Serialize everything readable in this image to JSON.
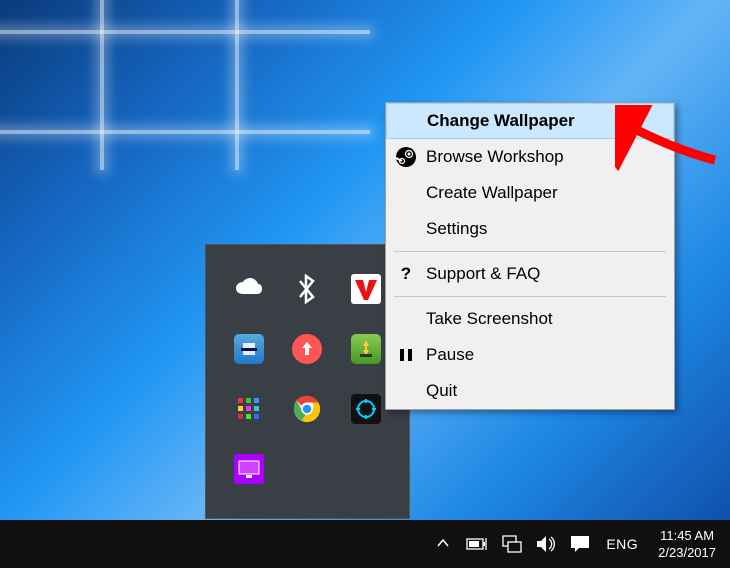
{
  "context_menu": {
    "items": [
      {
        "label": "Change Wallpaper",
        "icon": "",
        "highlighted": true
      },
      {
        "label": "Browse Workshop",
        "icon": "steam",
        "highlighted": false
      },
      {
        "label": "Create Wallpaper",
        "icon": "",
        "highlighted": false
      },
      {
        "label": "Settings",
        "icon": "",
        "highlighted": false
      }
    ],
    "items2": [
      {
        "label": "Support & FAQ",
        "icon": "?",
        "highlighted": false
      }
    ],
    "items3": [
      {
        "label": "Take Screenshot",
        "icon": "",
        "highlighted": false
      },
      {
        "label": "Pause",
        "icon": "pause",
        "highlighted": false
      },
      {
        "label": "Quit",
        "icon": "",
        "highlighted": false
      }
    ]
  },
  "tray_popup": {
    "items": [
      "onedrive",
      "bluetooth",
      "app-v",
      "intel",
      "updater",
      "idm",
      "pixels",
      "chrome",
      "wallpaper-engine",
      "monitor"
    ]
  },
  "taskbar": {
    "lang": "ENG",
    "time": "11:45 AM",
    "date": "2/23/2017",
    "icons": [
      "power",
      "network",
      "volume",
      "action-center"
    ]
  }
}
